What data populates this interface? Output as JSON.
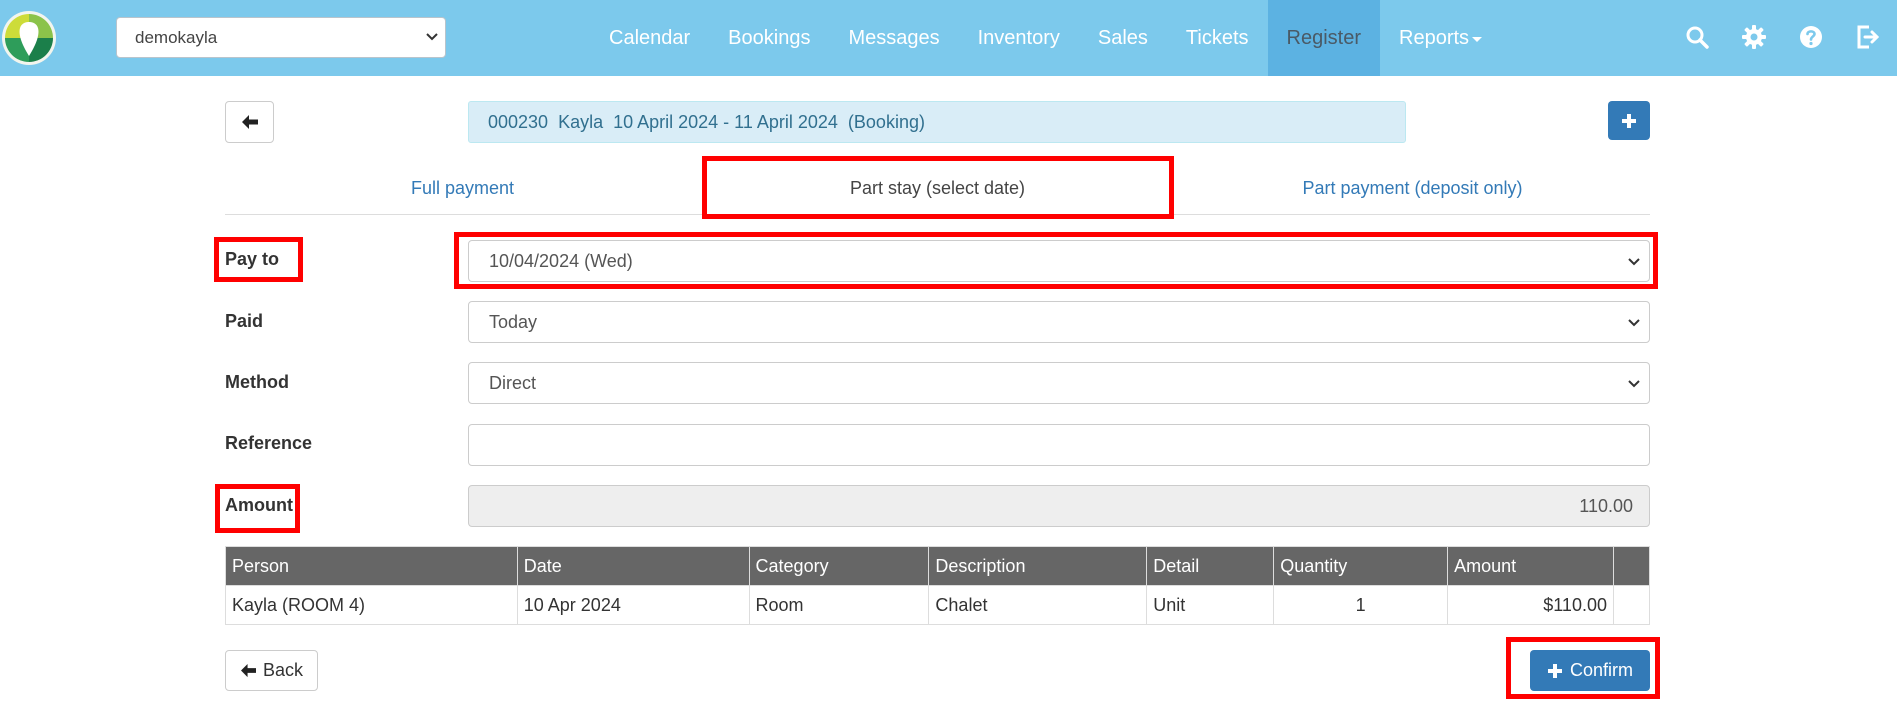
{
  "navbar": {
    "account": "demokayla",
    "items": [
      "Calendar",
      "Bookings",
      "Messages",
      "Inventory",
      "Sales",
      "Tickets",
      "Register",
      "Reports"
    ],
    "active": "Register",
    "icons": [
      "search-icon",
      "gear-icon",
      "help-icon",
      "logout-icon"
    ]
  },
  "booking": {
    "banner": "000230  Kayla  10 April 2024 - 11 April 2024  (Booking)"
  },
  "tabs": [
    {
      "label": "Full payment",
      "active": false
    },
    {
      "label": "Part stay (select date)",
      "active": true
    },
    {
      "label": "Part payment (deposit only)",
      "active": false
    }
  ],
  "form": {
    "pay_to": {
      "label": "Pay to",
      "value": "10/04/2024 (Wed)"
    },
    "paid": {
      "label": "Paid",
      "value": "Today"
    },
    "method": {
      "label": "Method",
      "value": "Direct"
    },
    "reference": {
      "label": "Reference",
      "value": ""
    },
    "amount": {
      "label": "Amount",
      "value": "110.00"
    }
  },
  "table": {
    "headers": [
      "Person",
      "Date",
      "Category",
      "Description",
      "Detail",
      "Quantity",
      "Amount",
      ""
    ],
    "rows": [
      [
        "Kayla (ROOM 4)",
        "10 Apr 2024",
        "Room",
        "Chalet",
        "Unit",
        "1",
        "$110.00",
        ""
      ]
    ]
  },
  "buttons": {
    "back": "Back",
    "confirm": "Confirm"
  },
  "colors": {
    "navbar": "#7cc9ec",
    "nav_active": "#5cb2e2",
    "primary": "#337ab7",
    "highlight": "#ff0000",
    "table_header": "#666666"
  }
}
